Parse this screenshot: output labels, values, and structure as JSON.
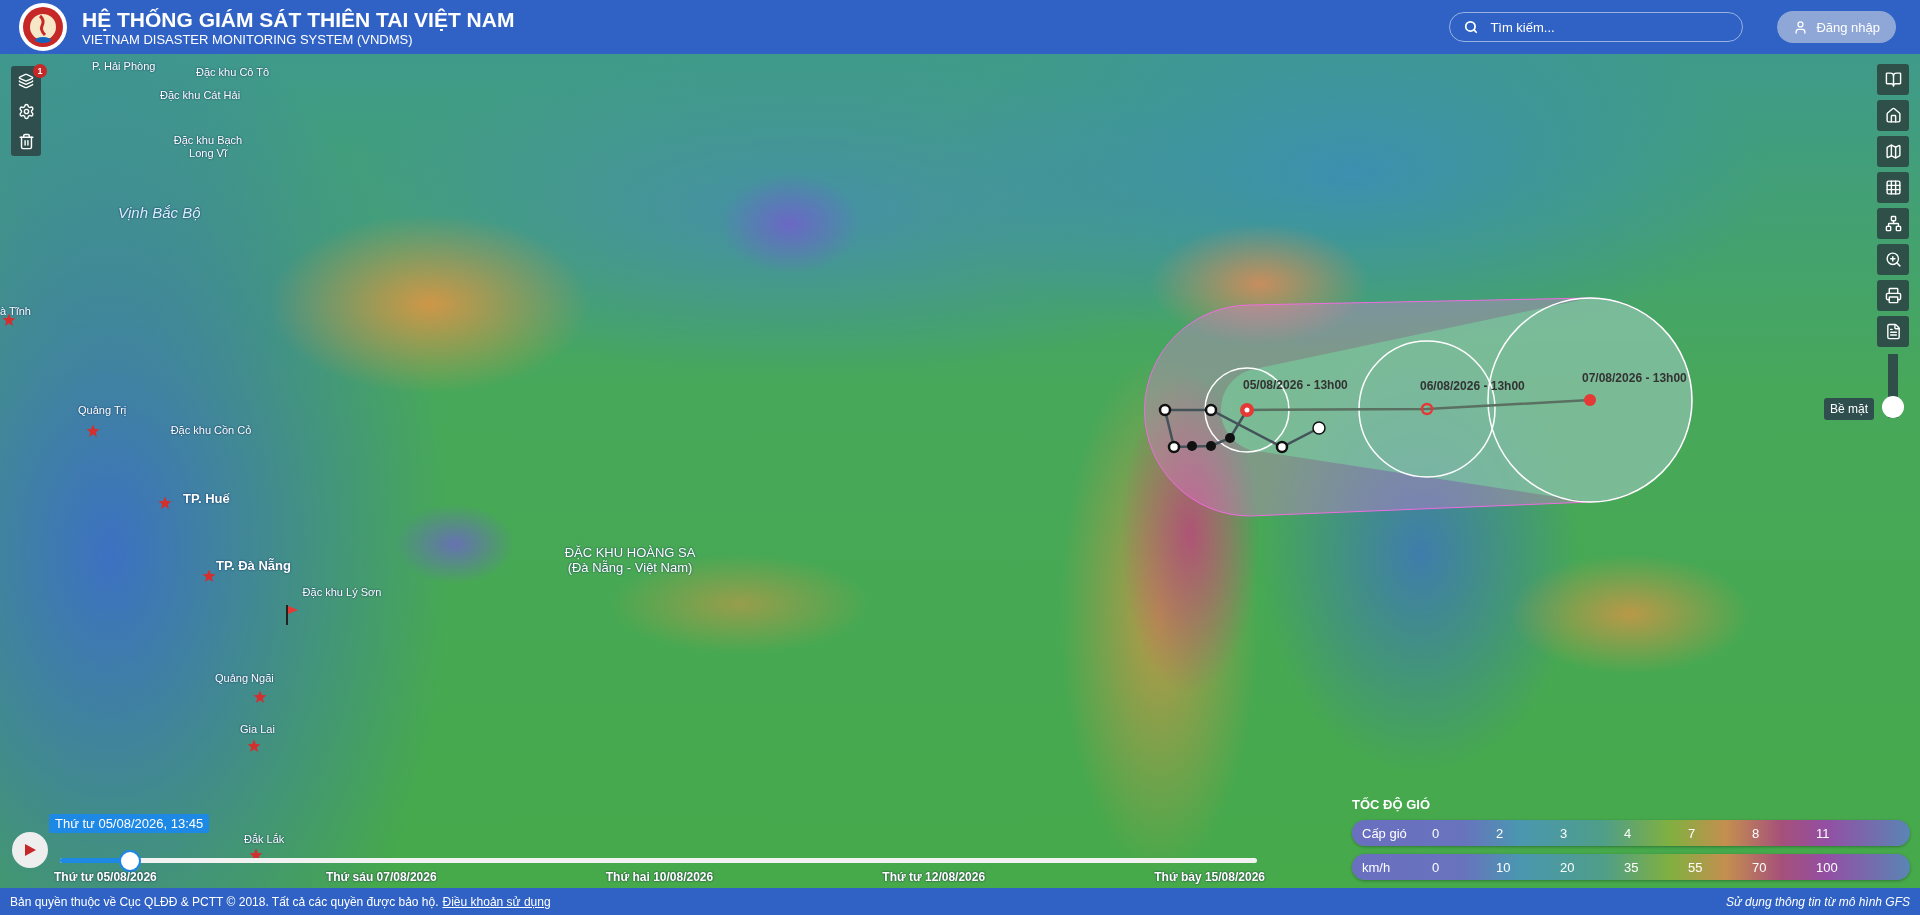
{
  "header": {
    "title": "HỆ THỐNG GIÁM SÁT THIÊN TAI VIỆT NAM",
    "subtitle": "VIETNAM DISASTER MONITORING SYSTEM (VNDMS)",
    "search": {
      "placeholder": "Tìm kiếm..."
    },
    "login": "Đăng nhập"
  },
  "map_tools": {
    "layer_badge": "1"
  },
  "map_labels": [
    {
      "text": "P. Hải Phòng",
      "kind": "place"
    },
    {
      "text": "Đặc khu Cô Tô",
      "kind": "place"
    },
    {
      "text": "Đặc khu Cát Hải",
      "kind": "place"
    },
    {
      "text": "Đặc khu Bạch Long Vĩ",
      "kind": "place"
    },
    {
      "text": "Vịnh Bắc Bộ",
      "kind": "sea"
    },
    {
      "text": "à Tĩnh",
      "kind": "place"
    },
    {
      "text": "Quảng Trị",
      "kind": "place"
    },
    {
      "text": "Đặc khu Cồn Cỏ",
      "kind": "place"
    },
    {
      "text": "TP. Huế",
      "kind": "city"
    },
    {
      "text": "TP. Đà Nẵng",
      "kind": "city"
    },
    {
      "text": "Đặc khu Lý Sơn",
      "kind": "place"
    },
    {
      "text": "Quảng Ngãi",
      "kind": "place"
    },
    {
      "text": "Gia Lai",
      "kind": "place"
    },
    {
      "text": "Đắk Lắk",
      "kind": "place"
    },
    {
      "text": "ĐẶC KHU HOÀNG SA (Đà Nẵng - Việt Nam)",
      "kind": "island"
    }
  ],
  "storm": {
    "forecast_labels": [
      "05/08/2026 - 13h00",
      "06/08/2026 - 13h00",
      "07/08/2026 - 13h00"
    ]
  },
  "layer_slider": {
    "label": "Bề mặt",
    "level": 0
  },
  "timeline": {
    "current": "Thứ tư 05/08/2026, 13:45",
    "level": 0.058,
    "ticks": [
      "Thứ tư 05/08/2026",
      "Thứ sáu 07/08/2026",
      "Thứ hai 10/08/2026",
      "Thứ tư 12/08/2026",
      "Thứ bảy 15/08/2026"
    ]
  },
  "legend": {
    "title": "TỐC ĐỘ GIÓ",
    "rows": [
      {
        "label": "Cấp gió",
        "values": [
          "0",
          "2",
          "3",
          "4",
          "7",
          "8",
          "11"
        ]
      },
      {
        "label": "km/h",
        "values": [
          "0",
          "10",
          "20",
          "35",
          "55",
          "70",
          "100"
        ]
      }
    ]
  },
  "footer": {
    "copyright": "Bản quyền thuộc về Cục QLĐĐ & PCTT © 2018. Tất cả các quyền được bảo hộ.",
    "terms_link": "Điều khoản sử dụng",
    "source": "Sử dụng thông tin từ mô hình GFS"
  }
}
